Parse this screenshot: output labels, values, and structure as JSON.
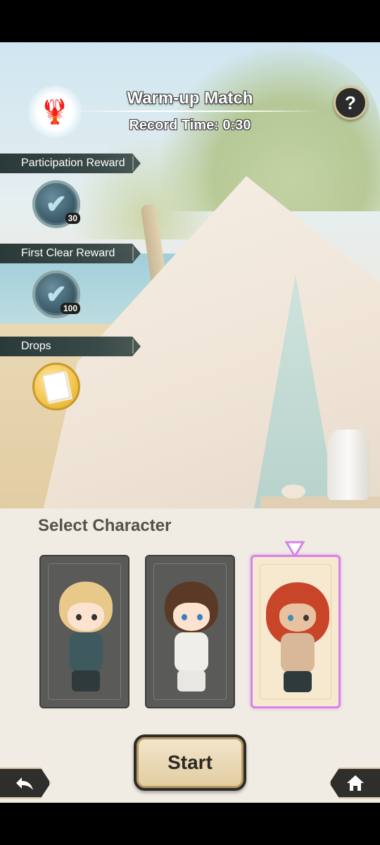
{
  "header": {
    "title": "Warm-up Match",
    "subtitle": "Record Time: 0:30",
    "help_label": "?"
  },
  "rewards": [
    {
      "label": "Participation Reward",
      "icon": "token-icon",
      "quantity": "30"
    },
    {
      "label": "First Clear Reward",
      "icon": "token-icon",
      "quantity": "100"
    },
    {
      "label": "Drops",
      "icon": "photo-card-icon",
      "quantity": ""
    }
  ],
  "select": {
    "title": "Select Character",
    "characters": [
      {
        "id": "blonde-character",
        "selected": false
      },
      {
        "id": "brown-hair-sunglasses-character",
        "selected": false
      },
      {
        "id": "red-hair-character",
        "selected": true
      }
    ]
  },
  "buttons": {
    "start_label": "Start",
    "back_icon": "back-arrow-icon",
    "home_icon": "home-icon"
  },
  "colors": {
    "selected_border": "#d483e8",
    "banner_bg": "#2a3a38",
    "panel_bg": "#f1ece3"
  }
}
